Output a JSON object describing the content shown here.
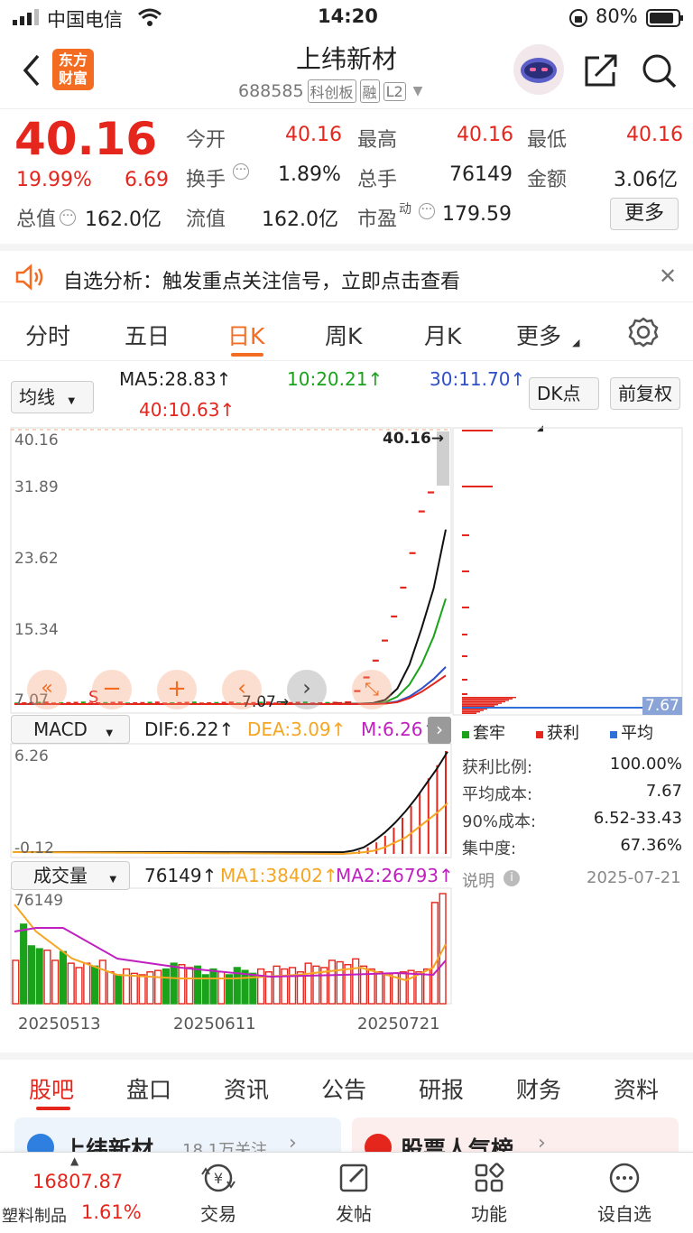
{
  "status_bar": {
    "carrier": "中国电信",
    "time": "14:20",
    "battery": "80%"
  },
  "header": {
    "logo_line1": "东方",
    "logo_line2": "财富",
    "title": "上纬新材",
    "code": "688585",
    "tags": [
      "科创板",
      "融",
      "L2"
    ]
  },
  "quote": {
    "price": "40.16",
    "change_pct": "19.99%",
    "change": "6.69",
    "open_label": "今开",
    "open": "40.16",
    "high_label": "最高",
    "high": "40.16",
    "low_label": "最低",
    "low": "40.16",
    "turnover_label": "换手",
    "turnover": "1.89%",
    "volume_label": "总手",
    "volume": "76149",
    "amount_label": "金额",
    "amount": "3.06亿",
    "mktcap_label": "总值",
    "mktcap": "162.0亿",
    "float_label": "流值",
    "float": "162.0亿",
    "pe_label": "市盈",
    "pe_sup": "动",
    "pe": "179.59",
    "more": "更多"
  },
  "notice": {
    "text": "自选分析：触发重点关注信号，立即点击查看"
  },
  "period_tabs": [
    "分时",
    "五日",
    "日K",
    "周K",
    "月K",
    "更多"
  ],
  "active_tab": "日K",
  "controls": {
    "ma_select": "均线",
    "ma5": "MA5:28.83↑",
    "ma10": "10:20.21↑",
    "ma30": "30:11.70↑",
    "ma40": "40:10.63↑",
    "dk": "DK点",
    "adjust": "前复权"
  },
  "kline": {
    "y_labels": [
      "40.16",
      "31.89",
      "23.62",
      "15.34",
      "7.07"
    ],
    "max_marker": "40.16→",
    "min_marker": "7.07→",
    "s_marker": "S"
  },
  "chip": {
    "price_tag": "7.67",
    "legend": [
      "套牢",
      "获利",
      "平均"
    ],
    "rows": [
      {
        "label": "获利比例:",
        "value": "100.00%"
      },
      {
        "label": "平均成本:",
        "value": "7.67"
      },
      {
        "label": "90%成本:",
        "value": "6.52-33.43"
      },
      {
        "label": "集中度:",
        "value": "67.36%"
      }
    ],
    "note_label": "说明",
    "date": "2025-07-21",
    "colors": {
      "trapped": "#1aa31a",
      "profit": "#e4261d",
      "average": "#2f6fd8"
    }
  },
  "macd": {
    "select": "MACD",
    "dif": "DIF:6.22↑",
    "dea": "DEA:3.09↑",
    "m": "M:6.26↑",
    "top_label": "6.26",
    "bottom_label": "-0.12"
  },
  "vol": {
    "select": "成交量",
    "value": "76149↑",
    "ma1": "MA1:38402↑",
    "ma2": "MA2:26793↑",
    "top_label": "76149",
    "dates": [
      "20250513",
      "20250611",
      "20250721"
    ]
  },
  "bottom_tabs": [
    "股吧",
    "盘口",
    "资讯",
    "公告",
    "研报",
    "财务",
    "资料"
  ],
  "active_bottom_tab": "股吧",
  "cards": {
    "left_title": "上纬新材",
    "left_sub": "18.1万关注",
    "right_title": "股票人气榜"
  },
  "dock": {
    "index_value": "16807.87",
    "index_name": "塑料制品",
    "index_change": "1.61%",
    "items": [
      "交易",
      "发帖",
      "功能",
      "设自选"
    ]
  },
  "chart_data": [
    {
      "type": "line",
      "title": "",
      "ylim": [
        7.07,
        40.16
      ],
      "series": [
        {
          "name": "MA5",
          "values": [
            7.07,
            7.1,
            7.1,
            7.12,
            7.2,
            7.6,
            9.0,
            12.0,
            16.5,
            21.5,
            28.83
          ]
        },
        {
          "name": "MA10",
          "values": [
            7.07,
            7.07,
            7.08,
            7.1,
            7.12,
            7.3,
            8.0,
            9.5,
            12.0,
            15.5,
            20.21
          ]
        },
        {
          "name": "MA30",
          "values": [
            7.07,
            7.07,
            7.08,
            7.08,
            7.1,
            7.15,
            7.4,
            8.0,
            9.0,
            10.2,
            11.7
          ]
        },
        {
          "name": "MA40",
          "values": [
            7.07,
            7.07,
            7.07,
            7.08,
            7.09,
            7.12,
            7.3,
            7.8,
            8.6,
            9.6,
            10.63
          ]
        }
      ],
      "candles_close": [
        7.2,
        7.3,
        8.7,
        10.4,
        12.5,
        15.0,
        18.0,
        21.6,
        25.9,
        31.1,
        33.47,
        40.16
      ]
    },
    {
      "type": "bar",
      "title": "",
      "series": [
        {
          "name": "MACD",
          "values": [
            0.2,
            0.4,
            0.7,
            1.1,
            1.6,
            2.2,
            2.9,
            3.7,
            4.6,
            5.4,
            6.26
          ]
        },
        {
          "name": "DIF",
          "values": [
            0.1,
            0.2,
            0.4,
            0.8,
            1.3,
            1.9,
            2.6,
            3.4,
            4.3,
            5.2,
            6.22
          ]
        },
        {
          "name": "DEA",
          "values": [
            0.0,
            0.05,
            0.1,
            0.2,
            0.4,
            0.7,
            1.0,
            1.5,
            2.0,
            2.5,
            3.09
          ]
        }
      ]
    },
    {
      "type": "bar",
      "title": "",
      "ylim": [
        0,
        76149
      ],
      "categories": [
        "20250513",
        "20250611",
        "20250721"
      ],
      "series": [
        {
          "name": "成交量",
          "values": [
            30000,
            55000,
            40000,
            38000,
            37000,
            30000,
            36000,
            28000,
            25000,
            28000,
            26000,
            30000,
            22000,
            20000,
            24000,
            21000,
            20000,
            22000,
            23000,
            24000,
            28000,
            27000,
            25000,
            26000,
            20000,
            24000,
            22000,
            20000,
            25000,
            23000,
            21000,
            24000,
            22000,
            26000,
            24000,
            25000,
            22000,
            28000,
            26000,
            25000,
            30000,
            29000,
            27000,
            31000,
            26000,
            24000,
            22000,
            20000,
            21000,
            22000,
            23000,
            22000,
            24000,
            70000,
            76149
          ]
        },
        {
          "name": "MA1",
          "values": [
            38402
          ]
        },
        {
          "name": "MA2",
          "values": [
            26793
          ]
        }
      ]
    }
  ]
}
